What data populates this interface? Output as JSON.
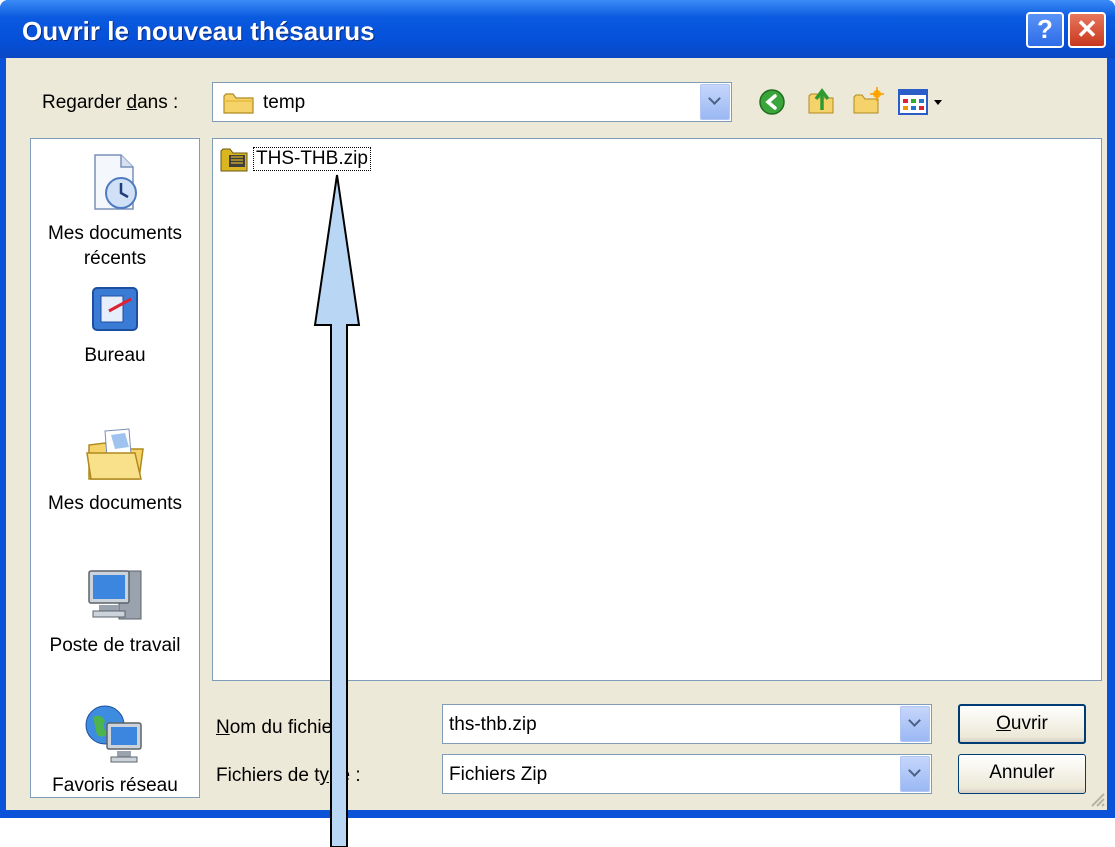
{
  "window": {
    "title": "Ouvrir le nouveau thésaurus",
    "help_label": "?",
    "close_label": "✕"
  },
  "lookin": {
    "prefix": "Regarder ",
    "accel": "d",
    "suffix": "ans :",
    "value": "temp"
  },
  "places": [
    {
      "icon": "recent-documents-icon",
      "label": "Mes documents récents"
    },
    {
      "icon": "desktop-icon",
      "label": "Bureau"
    },
    {
      "icon": "my-documents-icon",
      "label": "Mes documents"
    },
    {
      "icon": "my-computer-icon",
      "label": "Poste de travail"
    },
    {
      "icon": "network-places-icon",
      "label": "Favoris réseau"
    }
  ],
  "files": [
    {
      "icon": "zip-archive-icon",
      "name": "THS-THB.zip"
    }
  ],
  "filename": {
    "accel": "N",
    "label_rest": "om du fichier :",
    "value": "ths-thb.zip"
  },
  "filetype": {
    "label_before": "Fichiers de t",
    "accel": "y",
    "label_after": "pe :",
    "value": "Fichiers Zip"
  },
  "buttons": {
    "open_accel": "O",
    "open_rest": "uvrir",
    "cancel": "Annuler"
  },
  "toolbar_icons": [
    "back-icon",
    "up-folder-icon",
    "new-folder-icon",
    "view-menu-icon"
  ],
  "colors": {
    "titlebar": "#0550d8",
    "client": "#ece9d8",
    "annotation_arrow": "#b9d7f5"
  }
}
